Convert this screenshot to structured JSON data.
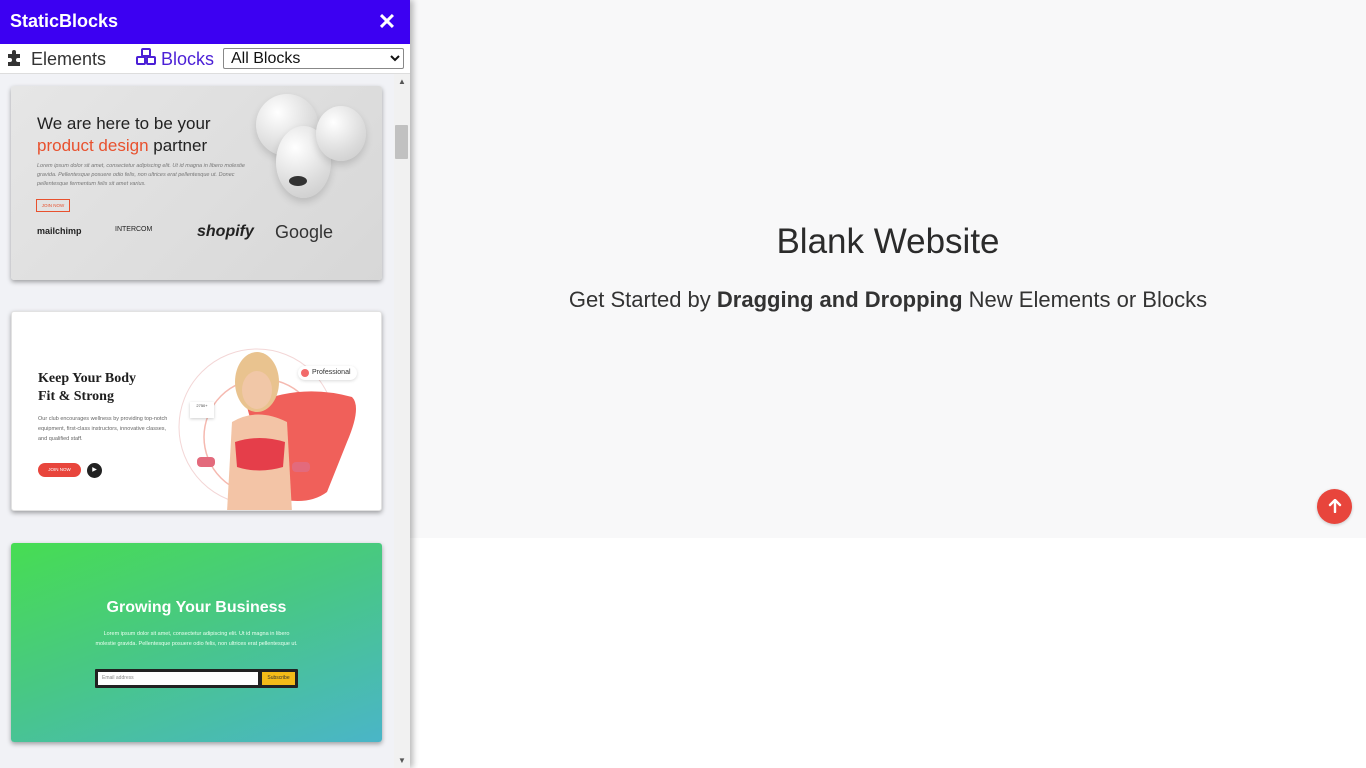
{
  "sidebar": {
    "title": "StaticBlocks",
    "close_icon": "close-icon",
    "tabs": [
      {
        "label": "Elements",
        "icon": "puzzle-icon"
      },
      {
        "label": "Blocks",
        "icon": "cubes-icon"
      }
    ],
    "filter": {
      "selected": "All Blocks",
      "options": [
        "All Blocks"
      ]
    }
  },
  "cards": [
    {
      "title_line1": "We are here to be your",
      "title_accent": "product design",
      "title_rest": " partner",
      "body": "Lorem ipsum dolor sit amet, consectetur adipiscing elit. Ut id magna in libero molestie gravida. Pellentesque posuere odio felis, non ultrices erat pellentesque ut. Donec pellentesque fermentum felis sit amet varius.",
      "button": "JOIN NOW",
      "logos": [
        "mailchimp",
        "INTERCOM",
        "shopify",
        "Google"
      ]
    },
    {
      "title_line1": "Keep Your Body",
      "title_line2": "Fit & Strong",
      "body": "Our club encourages wellness by providing top-notch equipment, first-class instructors, innovative classes, and qualified staff.",
      "button": "JOIN NOW",
      "badge": "Professional",
      "stat": "2750+"
    },
    {
      "title": "Growing Your Business",
      "body": "Lorem ipsum dolor sit amet, consectetur adipiscing elit. Ut id magna in libero molestie gravida. Pellentesque posuere odio felis, non ultrices erat pellentesque ut.",
      "input_placeholder": "Email address",
      "button": "Subscribe"
    }
  ],
  "main": {
    "title": "Blank Website",
    "subtitle_prefix": "Get Started by ",
    "subtitle_bold": "Dragging and Dropping",
    "subtitle_suffix": " New Elements or Blocks",
    "scroll_top_icon": "arrow-up-icon"
  },
  "colors": {
    "header": "#3c00f2",
    "accent_tab": "#4b1fd6",
    "scroll_button": "#e8453c",
    "canvas_bg": "#f8f8f9"
  }
}
